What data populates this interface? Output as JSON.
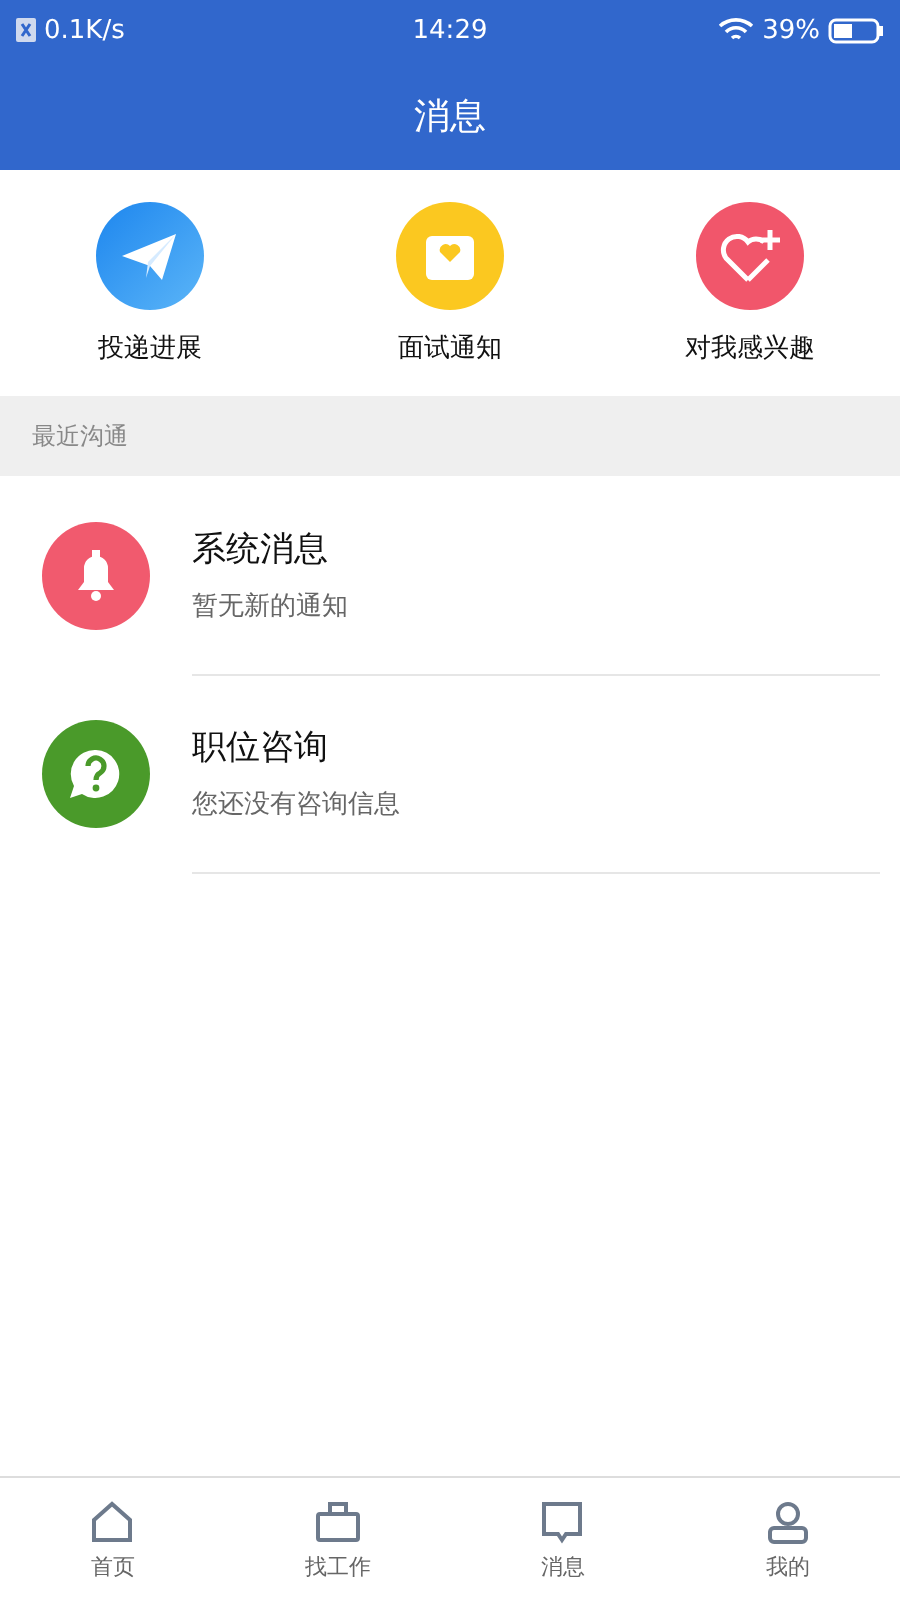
{
  "status_bar": {
    "speed": "0.1K/s",
    "time": "14:29",
    "battery": "39%"
  },
  "header": {
    "title": "消息"
  },
  "shortcuts": [
    {
      "label": "投递进展"
    },
    {
      "label": "面试通知"
    },
    {
      "label": "对我感兴趣"
    }
  ],
  "section": {
    "title": "最近沟通"
  },
  "messages": [
    {
      "title": "系统消息",
      "subtitle": "暂无新的通知"
    },
    {
      "title": "职位咨询",
      "subtitle": "您还没有咨询信息"
    }
  ],
  "tab_bar": [
    {
      "label": "首页"
    },
    {
      "label": "找工作"
    },
    {
      "label": "消息"
    },
    {
      "label": "我的"
    }
  ]
}
